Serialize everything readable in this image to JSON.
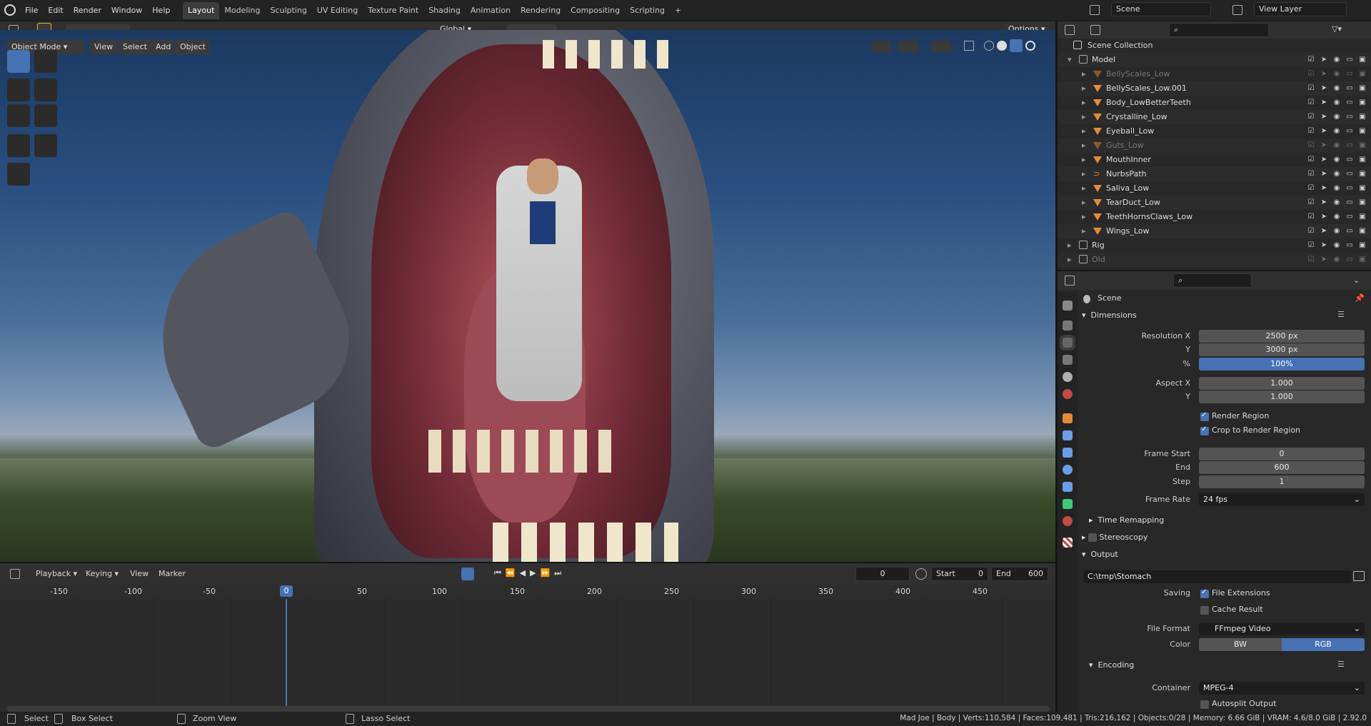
{
  "app": {
    "menus": [
      "File",
      "Edit",
      "Render",
      "Window",
      "Help"
    ]
  },
  "workspaces": [
    "Layout",
    "Modeling",
    "Sculpting",
    "UV Editing",
    "Texture Paint",
    "Shading",
    "Animation",
    "Rendering",
    "Compositing",
    "Scripting"
  ],
  "active_workspace": "Layout",
  "scene": {
    "name": "Scene",
    "view_layer": "View Layer"
  },
  "viewport": {
    "mode": "Object Mode",
    "menus": [
      "View",
      "Select",
      "Add",
      "Object"
    ],
    "transform_orientation": "Global",
    "options_label": "Options"
  },
  "outliner": {
    "root": "Scene Collection",
    "rows": [
      {
        "name": "Model",
        "kind": "collection",
        "dim": false
      },
      {
        "name": "BellyScales_Low",
        "kind": "mesh",
        "dim": true
      },
      {
        "name": "BellyScales_Low.001",
        "kind": "mesh",
        "dim": false
      },
      {
        "name": "Body_LowBetterTeeth",
        "kind": "mesh",
        "dim": false
      },
      {
        "name": "Crystalline_Low",
        "kind": "mesh",
        "dim": false
      },
      {
        "name": "Eyeball_Low",
        "kind": "mesh",
        "dim": false
      },
      {
        "name": "Guts_Low",
        "kind": "mesh",
        "dim": true
      },
      {
        "name": "MouthInner",
        "kind": "mesh",
        "dim": false
      },
      {
        "name": "NurbsPath",
        "kind": "curve",
        "dim": false
      },
      {
        "name": "Saliva_Low",
        "kind": "mesh",
        "dim": false
      },
      {
        "name": "TearDuct_Low",
        "kind": "mesh",
        "dim": false
      },
      {
        "name": "TeethHornsClaws_Low",
        "kind": "mesh",
        "dim": false
      },
      {
        "name": "Wings_Low",
        "kind": "mesh",
        "dim": false
      },
      {
        "name": "Rig",
        "kind": "collection",
        "dim": false
      },
      {
        "name": "Old",
        "kind": "collection",
        "dim": true
      }
    ]
  },
  "properties": {
    "context": "Scene",
    "dimensions_label": "Dimensions",
    "res_x_label": "Resolution X",
    "res_x": "2500 px",
    "res_y_label": "Y",
    "res_y": "3000 px",
    "res_pct_label": "%",
    "res_pct": "100%",
    "aspect_x_label": "Aspect X",
    "aspect_x": "1.000",
    "aspect_y_label": "Y",
    "aspect_y": "1.000",
    "render_region": "Render Region",
    "crop_region": "Crop to Render Region",
    "frame_start_label": "Frame Start",
    "frame_start": "0",
    "frame_end_label": "End",
    "frame_end": "600",
    "frame_step_label": "Step",
    "frame_step": "1",
    "frame_rate_label": "Frame Rate",
    "frame_rate": "24 fps",
    "time_remap": "Time Remapping",
    "stereo": "Stereoscopy",
    "output": "Output",
    "output_path": "C:\\tmp\\Stomach",
    "saving_label": "Saving",
    "file_ext": "File Extensions",
    "cache_result": "Cache Result",
    "file_format_label": "File Format",
    "file_format": "FFmpeg Video",
    "color_label": "Color",
    "color_bw": "BW",
    "color_rgb": "RGB",
    "encoding": "Encoding",
    "container_label": "Container",
    "container": "MPEG-4",
    "autosplit": "Autosplit Output"
  },
  "timeline": {
    "menus": [
      "Playback",
      "Keying",
      "View",
      "Marker"
    ],
    "current_frame": "0",
    "start_label": "Start",
    "start": "0",
    "end_label": "End",
    "end": "600",
    "ticks": [
      "-150",
      "-100",
      "-50",
      "0",
      "50",
      "100",
      "150",
      "200",
      "250",
      "300",
      "350",
      "400",
      "450"
    ]
  },
  "status": {
    "select": "Select",
    "box_select": "Box Select",
    "zoom_view": "Zoom View",
    "lasso_select": "Lasso Select",
    "stats": "Mad Joe | Body | Verts:110,584 | Faces:109,481 | Tris:216,162 | Objects:0/28 | Memory: 6.66 GiB | VRAM: 4.6/8.0 GiB | 2.92.0"
  },
  "colors": {
    "accent": "#4772b3",
    "mesh_icon": "#e38a3a",
    "modifier_icon": "#6b9ee6",
    "data_icon": "#3fc97a"
  }
}
